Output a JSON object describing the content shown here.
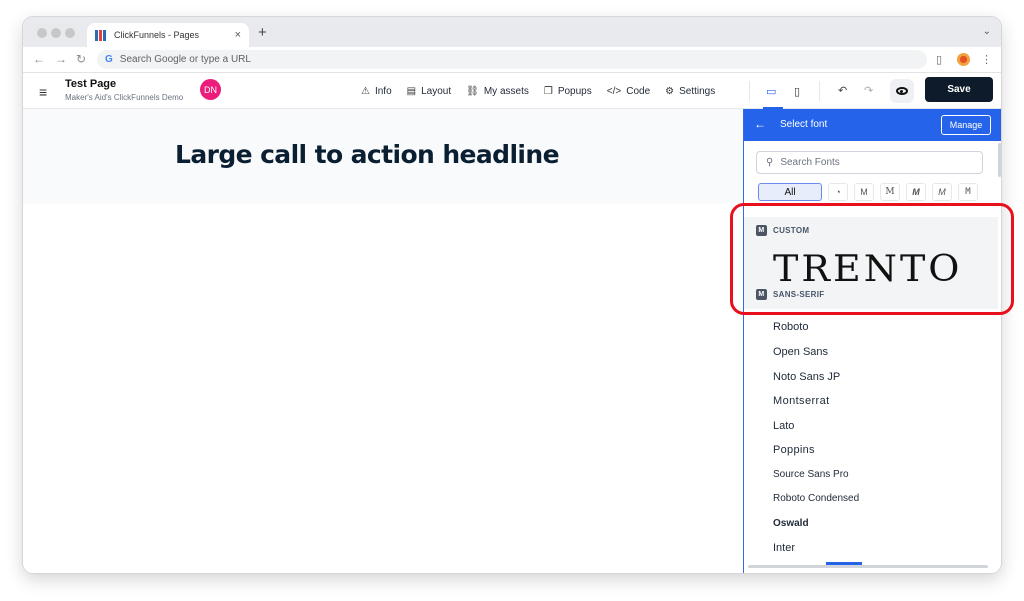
{
  "browser": {
    "tab_title": "ClickFunnels - Pages",
    "tab_close": "×",
    "new_tab": "+",
    "address_placeholder": "Search Google or type a URL",
    "google_letter": "G"
  },
  "header": {
    "page_title": "Test Page",
    "page_subtitle": "Maker's Aid's ClickFunnels Demo",
    "avatar_initials": "DN",
    "menu": [
      {
        "icon": "⚠",
        "label": "Info"
      },
      {
        "icon": "▤",
        "label": "Layout"
      },
      {
        "icon": "⛓",
        "label": "My assets"
      },
      {
        "icon": "❐",
        "label": "Popups"
      },
      {
        "icon": "</>",
        "label": "Code"
      },
      {
        "icon": "⚙",
        "label": "Settings"
      }
    ],
    "save_label": "Save"
  },
  "canvas": {
    "headline": "Large call to action headline"
  },
  "font_panel": {
    "title": "Select font",
    "manage_label": "Manage",
    "search_placeholder": "Search Fonts",
    "filters": [
      "All",
      "◔",
      "M",
      "M",
      "M",
      "M",
      "M"
    ],
    "custom_category": "CUSTOM",
    "category_badge": "M",
    "custom_font_preview": "TRENTO",
    "sans_serif_category": "SANS-SERIF",
    "fonts": [
      "Roboto",
      "Open Sans",
      "Noto Sans JP",
      "Montserrat",
      "Lato",
      "Poppins",
      "Source Sans Pro",
      "Roboto Condensed",
      "Oswald",
      "Inter"
    ]
  },
  "colors": {
    "accent": "#2563eb",
    "save_bg": "#0d1b2a",
    "avatar": "#ec1c7c",
    "highlight": "#e8101c"
  }
}
